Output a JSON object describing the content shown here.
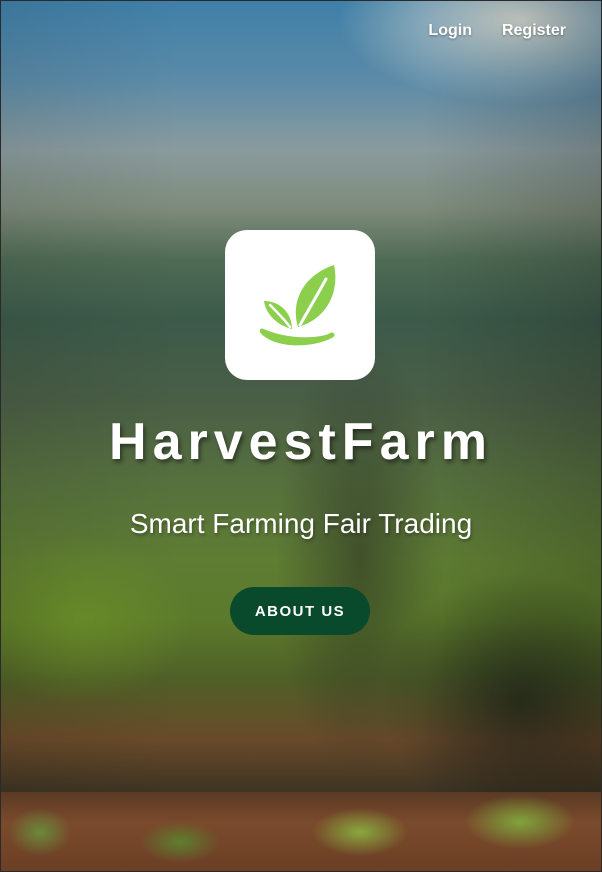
{
  "nav": {
    "login_label": "Login",
    "register_label": "Register"
  },
  "hero": {
    "logo_icon": "leaf-sprout-icon",
    "brand_name": "HarvestFarm",
    "tagline": "Smart Farming Fair Trading",
    "about_button_label": "ABOUT US"
  },
  "colors": {
    "logo_green": "#8ccf4d",
    "button_green": "#0a4a2c",
    "text": "#ffffff"
  }
}
